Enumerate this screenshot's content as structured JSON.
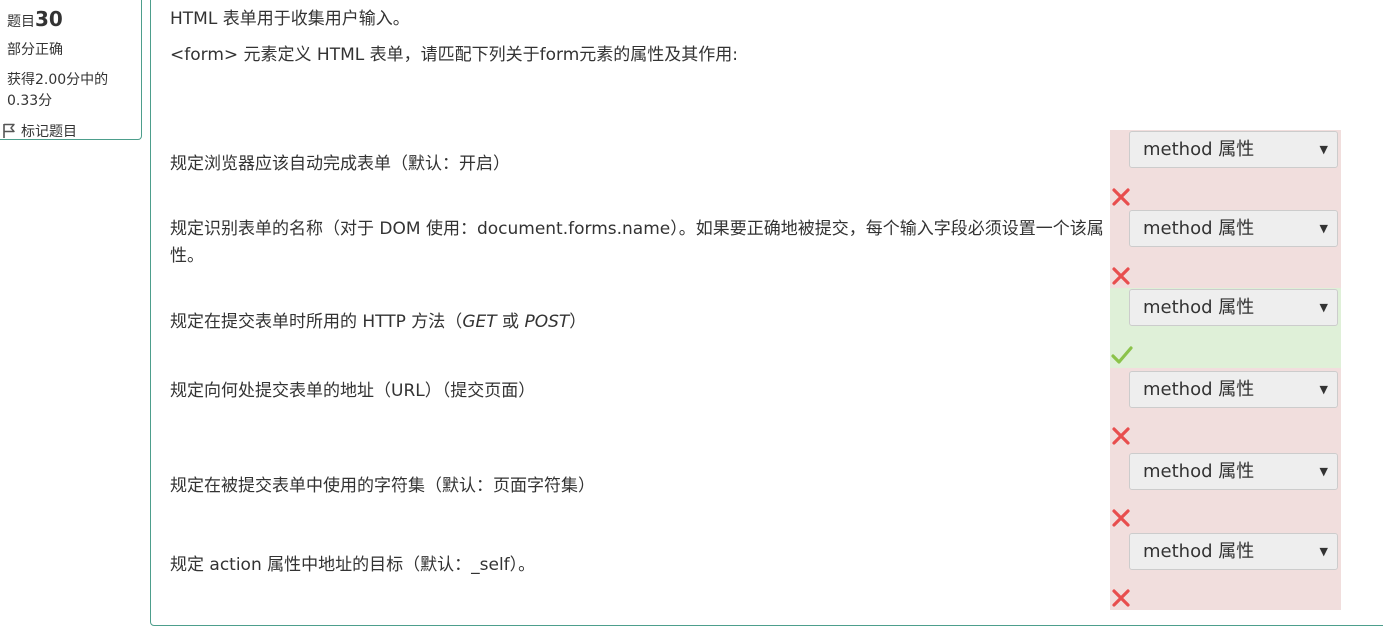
{
  "info": {
    "title_prefix": "题目",
    "number": "30",
    "state": "部分正确",
    "grade": "获得2.00分中的0.33分",
    "flag_label": "标记题目"
  },
  "question": {
    "line1": "HTML 表单用于收集用户输入。",
    "line2": "<form> 元素定义 HTML 表单，请匹配下列关于form元素的属性及其作用:"
  },
  "rows": [
    {
      "text": "规定浏览器应该自动完成表单（默认：开启）",
      "selected": "method 属性",
      "status": "incorrect"
    },
    {
      "text": "规定识别表单的名称（对于 DOM 使用：document.forms.name）。如果要正确地被提交，每个输入字段必须设置一个该属性。",
      "selected": "method 属性",
      "status": "incorrect"
    },
    {
      "text_before": "规定在提交表单时所用的 HTTP 方法（",
      "em1": "GET",
      "text_mid": " 或 ",
      "em2": "POST",
      "text_after": "）",
      "selected": "method 属性",
      "status": "correct"
    },
    {
      "text": "规定向何处提交表单的地址（URL）（提交页面）",
      "selected": "method 属性",
      "status": "incorrect"
    },
    {
      "text": "规定在被提交表单中使用的字符集（默认：页面字符集）",
      "selected": "method 属性",
      "status": "incorrect"
    },
    {
      "text": "规定 action 属性中地址的目标（默认：_self）。",
      "selected": "method 属性",
      "status": "incorrect"
    }
  ],
  "icons": {
    "incorrect": "cross-icon",
    "correct": "check-icon",
    "flag": "flag-icon",
    "caret": "caret-down-icon"
  },
  "colors": {
    "incorrect_bg": "#f1dedd",
    "correct_bg": "#dff0d8",
    "incorrect_mark": "#e84e4e",
    "correct_mark": "#8bc34a",
    "border": "#4d9e8c"
  }
}
